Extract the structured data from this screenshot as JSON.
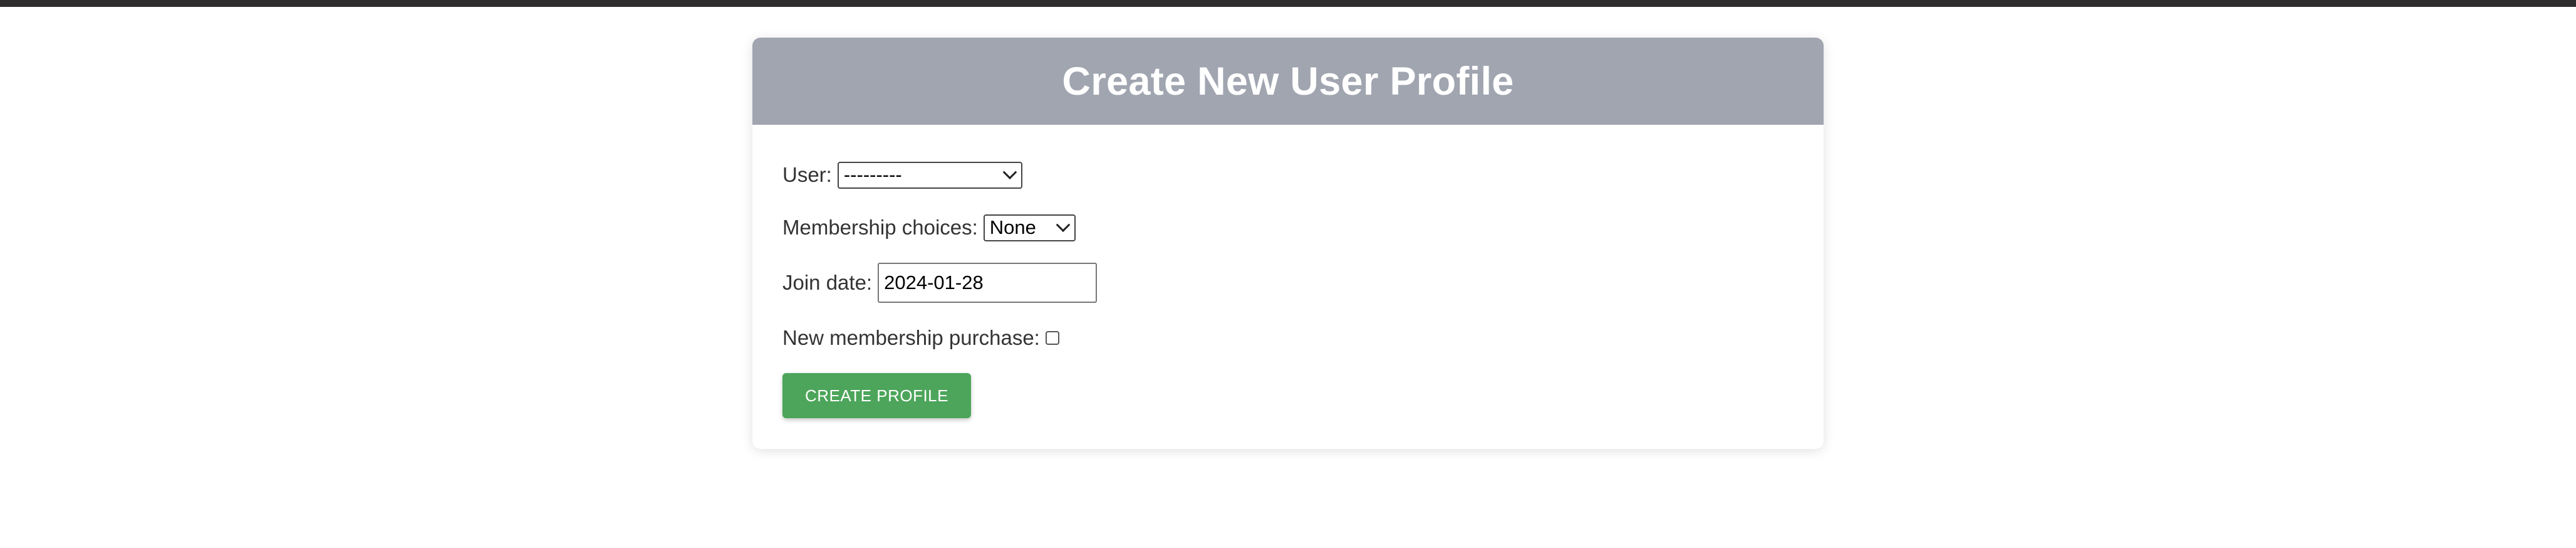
{
  "page": {
    "title": "Create New User Profile"
  },
  "form": {
    "user": {
      "label": "User:",
      "selected": "---------"
    },
    "membership": {
      "label": "Membership choices:",
      "selected": "None"
    },
    "join_date": {
      "label": "Join date:",
      "value": "2024-01-28"
    },
    "new_purchase": {
      "label": "New membership purchase:",
      "checked": false
    },
    "submit_label": "CREATE PROFILE"
  },
  "colors": {
    "header_bg": "#a0a5b0",
    "button_bg": "#4ca55a",
    "top_bar": "#2f2d2d"
  },
  "icons": {
    "select_arrow": "chevron-down-icon"
  }
}
